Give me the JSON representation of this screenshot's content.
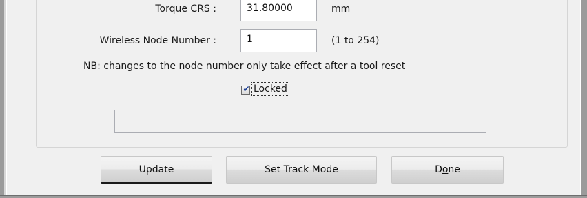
{
  "fields": {
    "torque_crs": {
      "label": "Torque CRS :",
      "value": "31.80000",
      "unit": "mm"
    },
    "wireless_node": {
      "label": "Wireless Node Number :",
      "value": "1",
      "hint": "(1 to 254)"
    }
  },
  "note": "NB: changes to the node number only take effect after a tool reset",
  "locked": {
    "label": "Locked",
    "checked": true,
    "check_glyph": "✔"
  },
  "status_text": "",
  "buttons": {
    "update": "Update",
    "set_track_mode": "Set Track Mode",
    "done_prefix": "D",
    "done_mnemonic": "o",
    "done_suffix": "ne"
  },
  "colors": {
    "dialog_bg": "#f0f0f0",
    "checkbox_tick": "#1c3f94"
  }
}
